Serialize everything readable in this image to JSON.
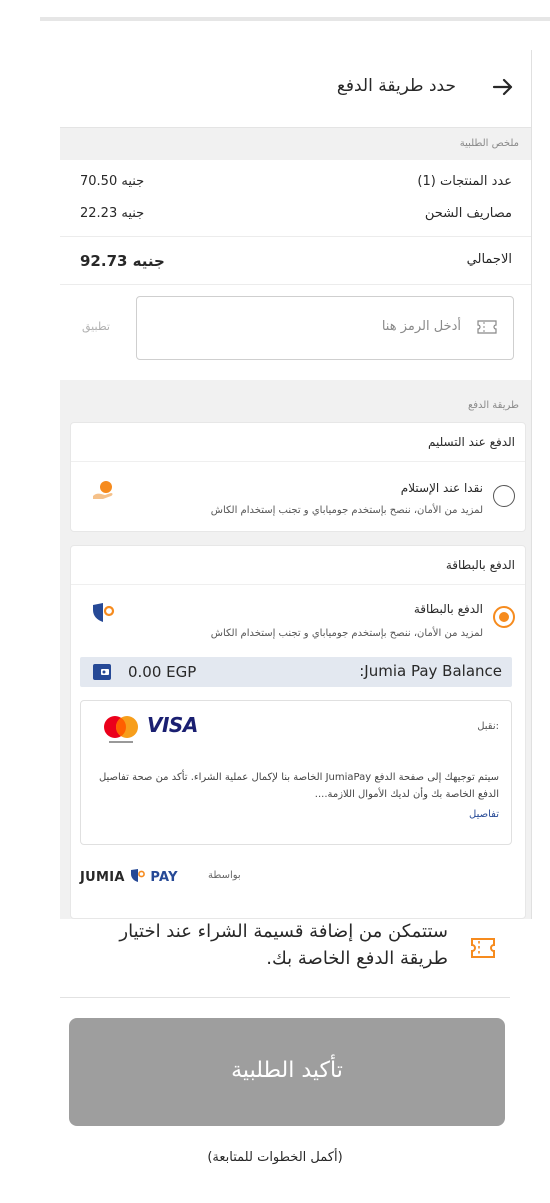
{
  "header": {
    "title": "حدد طريقة الدفع",
    "back_icon": "arrow-right-icon"
  },
  "summary": {
    "section_label": "ملخص الطلبية",
    "items_label": "عدد المنتجات (1)",
    "items_value": "جنيه 70.50",
    "shipping_label": "مصاريف الشحن",
    "shipping_value": "جنيه 22.23",
    "total_label": "الاجمالي",
    "total_value": "جنيه 92.73"
  },
  "coupon": {
    "placeholder": "أدخل الرمز هنا",
    "apply_label": "تطبيق",
    "icon": "voucher-icon"
  },
  "payment": {
    "section_label": "طريقة الدفع",
    "cod": {
      "heading": "الدفع عند التسليم",
      "option_title": "نقدا عند الإستلام",
      "option_subtitle": "لمزيد من الأمان، ننصح بإستخدم جومياباي و تجنب إستخدام الكاش",
      "selected": false
    },
    "card": {
      "heading": "الدفع بالبطاقة",
      "option_title": "الدفع بالبطاقة",
      "option_subtitle": "لمزيد من الأمان، ننصح بإستخدم جومياباي و تجنب إستخدام الكاش",
      "selected": true,
      "balance_label": ":Jumia Pay Balance",
      "balance_amount": "0.00 EGP",
      "accepted_label": "نقبل:",
      "visa_label": "VISA",
      "note": "سيتم توجيهك إلى صفحة الدفع JumiaPay الخاصة بنا لإكمال عملية الشراء. تأكد من صحة تفاصيل الدفع الخاصة بك وأن لديك الأموال اللازمة....",
      "details_link": "تفاصيل",
      "powered_by": "بواسطة",
      "jumia_logo": "JUMIA",
      "pay_logo": "PAY"
    }
  },
  "notice": {
    "text": "ستتمكن من إضافة قسيمة الشراء عند اختيار طريقة الدفع الخاصة بك.",
    "icon": "voucher-icon"
  },
  "confirm": {
    "label": "تأكيد الطلبية",
    "hint": "(أكمل الخطوات للمتابعة)"
  },
  "colors": {
    "accent": "#f68b1e",
    "button_disabled": "#9e9e9e",
    "jumiapay_blue": "#264996"
  }
}
